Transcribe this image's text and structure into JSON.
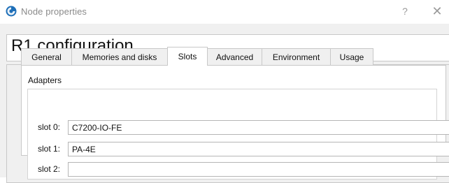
{
  "window": {
    "title": "Node properties",
    "help_label": "?",
    "close_label": "✕",
    "icon": "gns3-app-icon"
  },
  "header": {
    "title": "R1 configuration"
  },
  "tabs": [
    {
      "label": "General",
      "active": false
    },
    {
      "label": "Memories and disks",
      "active": false
    },
    {
      "label": "Slots",
      "active": true
    },
    {
      "label": "Advanced",
      "active": false
    },
    {
      "label": "Environment",
      "active": false
    },
    {
      "label": "Usage",
      "active": false
    }
  ],
  "adapters": {
    "group_label": "Adapters",
    "slots": [
      {
        "label": "slot 0:",
        "value": "C7200-IO-FE"
      },
      {
        "label": "slot 1:",
        "value": "PA-4E"
      },
      {
        "label": "slot 2:",
        "value": ""
      }
    ]
  },
  "colors": {
    "dialog_background": "#f0f0f0",
    "panel_background": "#ffffff",
    "border": "#c8c8c8",
    "title_text": "#8a8a8a"
  }
}
